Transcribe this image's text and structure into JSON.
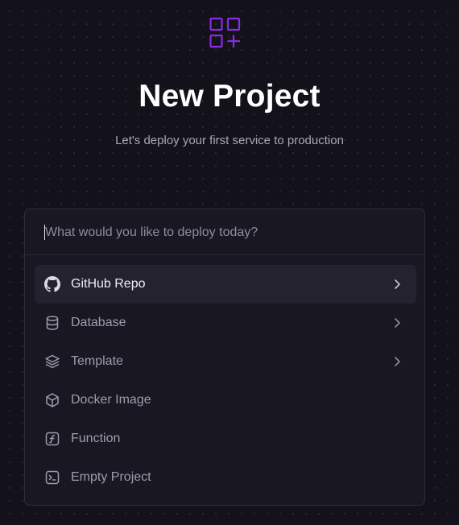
{
  "header": {
    "logo_icon": "grid-plus-icon",
    "title": "New Project",
    "subtitle": "Let's deploy your first service to production"
  },
  "search": {
    "value": "",
    "placeholder": "What would you like to deploy today?"
  },
  "menu": {
    "items": [
      {
        "label": "GitHub Repo",
        "icon": "github-icon",
        "has_submenu": true,
        "highlighted": true
      },
      {
        "label": "Database",
        "icon": "database-icon",
        "has_submenu": true,
        "highlighted": false
      },
      {
        "label": "Template",
        "icon": "layers-icon",
        "has_submenu": true,
        "highlighted": false
      },
      {
        "label": "Docker Image",
        "icon": "cube-icon",
        "has_submenu": false,
        "highlighted": false
      },
      {
        "label": "Function",
        "icon": "function-icon",
        "has_submenu": false,
        "highlighted": false
      },
      {
        "label": "Empty Project",
        "icon": "terminal-icon",
        "has_submenu": false,
        "highlighted": false
      }
    ]
  },
  "colors": {
    "background": "#13121b",
    "card": "#181722",
    "accent": "#8a2be2",
    "highlight": "#23222e"
  }
}
